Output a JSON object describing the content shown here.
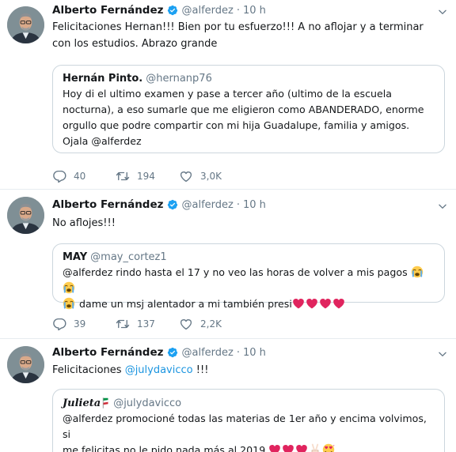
{
  "tweets": [
    {
      "author": "Alberto Fernández",
      "handle": "@alferdez",
      "time": "10 h",
      "text": "Felicitaciones Hernan!!! Bien por tu esfuerzo!!! A no aflojar y a terminar con los estudios. Abrazo grande",
      "quote": {
        "author": "Hernán Pinto.",
        "handle": "@hernanp76",
        "text": "Hoy di el ultimo examen y  pase a tercer año (ultimo de la escuela nocturna), a eso sumarle que me eligieron como ABANDERADO, enorme orgullo que podre compartir con mi hija Guadalupe, familia y amigos. Ojala @alferdez"
      },
      "replies": "40",
      "retweets": "194",
      "likes": "3,0K"
    },
    {
      "author": "Alberto Fernández",
      "handle": "@alferdez",
      "time": "10 h",
      "text": "No aflojes!!!",
      "quote": {
        "author": "MAY",
        "handle": "@may_cortez1",
        "text_line1": "@alferdez rindo hasta el 17 y no veo las horas de volver a mis pagos",
        "text_line2": "dame un msj alentador a mi también presi"
      },
      "replies": "39",
      "retweets": "137",
      "likes": "2,2K"
    },
    {
      "author": "Alberto Fernández",
      "handle": "@alferdez",
      "time": "10 h",
      "text_prefix": "Felicitaciones",
      "text_mention": "@julydavicco",
      "text_suffix": "!!!",
      "quote": {
        "author": "Julieta",
        "handle": "@julydavicco",
        "text_line1": "@alferdez promocioné todas las materias de 1er año y encima volvimos, si",
        "text_line2": "me felicitas no le pido nada más al 2019"
      }
    }
  ],
  "icons": {
    "reply": "reply-icon",
    "retweet": "retweet-icon",
    "like": "heart-outline-icon",
    "verified": "verified-badge-icon",
    "caret": "chevron-down-icon"
  },
  "colors": {
    "link": "#1b95e0",
    "verified": "#1da1f2",
    "secondary": "#657786",
    "heart_emoji": "#e0245e"
  }
}
